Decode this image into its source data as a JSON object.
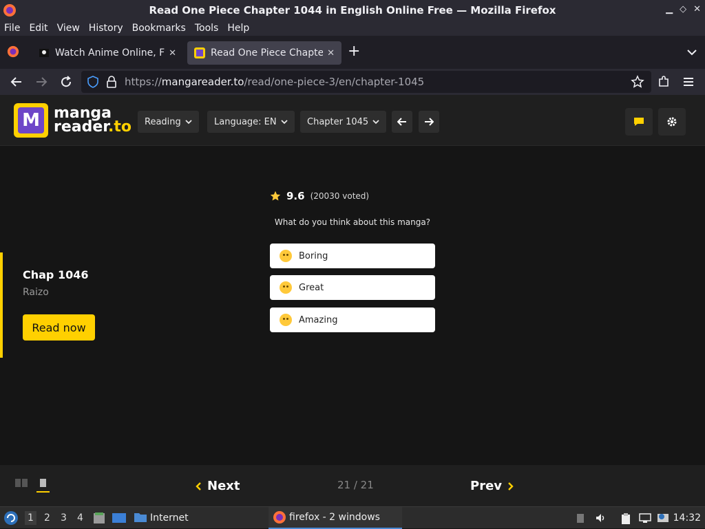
{
  "window": {
    "title": "Read One Piece Chapter 1044 in English Online Free — Mozilla Firefox"
  },
  "menu": [
    "File",
    "Edit",
    "View",
    "History",
    "Bookmarks",
    "Tools",
    "Help"
  ],
  "tabs": [
    {
      "label": "Watch Anime Online, Free",
      "active": false
    },
    {
      "label": "Read One Piece Chapter",
      "active": true
    }
  ],
  "urlbar": {
    "prefix": "https://",
    "host": "mangareader.to",
    "path": "/read/one-piece-3/en/chapter-1045"
  },
  "site": {
    "logo_line1": "manga",
    "logo_line2a": "reader",
    "logo_line2b": ".to",
    "logo_letter": "M",
    "mode_select": "Reading",
    "language_select": "Language: EN",
    "chapter_select": "Chapter 1045",
    "accent_color": "#ffd000"
  },
  "next_chapter": {
    "title": "Chap 1046",
    "group": "Raizo",
    "button": "Read now"
  },
  "rating": {
    "score": "9.6",
    "voted": "(20030 voted)",
    "question": "What do you think about this manga?",
    "options": [
      "Boring",
      "Great",
      "Amazing"
    ]
  },
  "reader_bar": {
    "next_label": "Next",
    "prev_label": "Prev",
    "page_count": "21 / 21"
  },
  "taskbar": {
    "workspaces": [
      "1",
      "2",
      "3",
      "4"
    ],
    "launcher_label": "Internet",
    "firefox_task": "firefox - 2 windows",
    "clock": "14:32"
  }
}
